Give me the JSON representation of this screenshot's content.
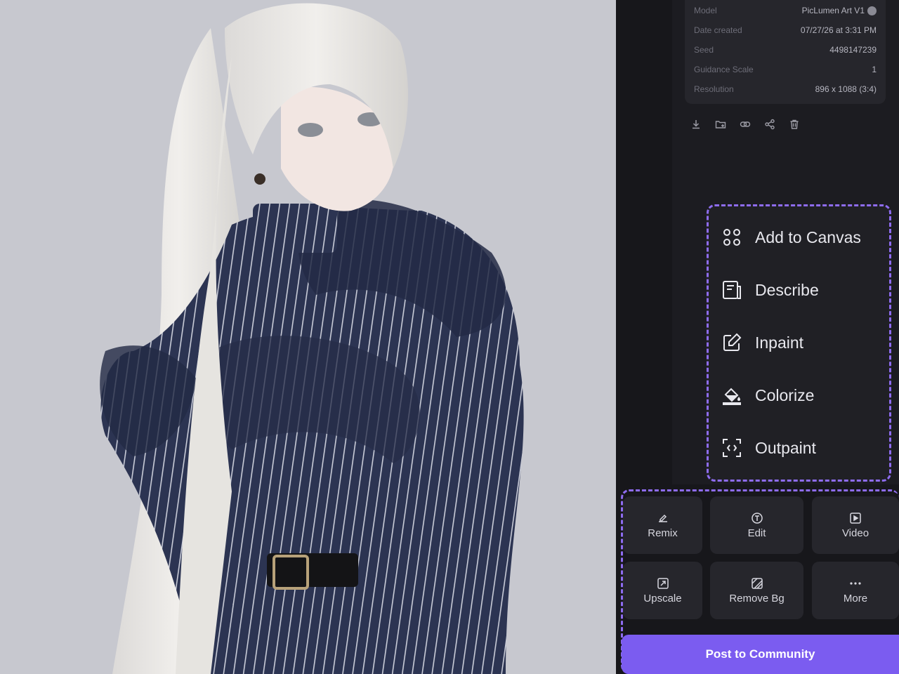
{
  "info": {
    "model_label": "Model",
    "model_value": "PicLumen Art V1",
    "date_label": "Date created",
    "date_value": "07/27/26 at 3:31 PM",
    "seed_label": "Seed",
    "seed_value": "4498147239",
    "guidance_label": "Guidance Scale",
    "guidance_value": "1",
    "resolution_label": "Resolution",
    "resolution_value": "896 x 1088 (3:4)"
  },
  "action_icons": [
    "download-icon",
    "folder-add-icon",
    "link-icon",
    "share-icon",
    "trash-icon"
  ],
  "menu": {
    "items": [
      {
        "label": "Add to Canvas",
        "icon": "canvas-icon"
      },
      {
        "label": "Describe",
        "icon": "describe-icon"
      },
      {
        "label": "Inpaint",
        "icon": "inpaint-icon"
      },
      {
        "label": "Colorize",
        "icon": "colorize-icon"
      },
      {
        "label": "Outpaint",
        "icon": "outpaint-icon"
      }
    ]
  },
  "tools": {
    "remix": "Remix",
    "edit": "Edit",
    "video": "Video",
    "upscale": "Upscale",
    "remove_bg": "Remove Bg",
    "more": "More"
  },
  "post_button": "Post to Community",
  "colors": {
    "accent": "#7b5cf0",
    "highlight_dash": "#8e6cf0",
    "panel_bg": "#17171b",
    "card_bg": "#26262c",
    "artwork_bg": "#c7c8cf"
  }
}
